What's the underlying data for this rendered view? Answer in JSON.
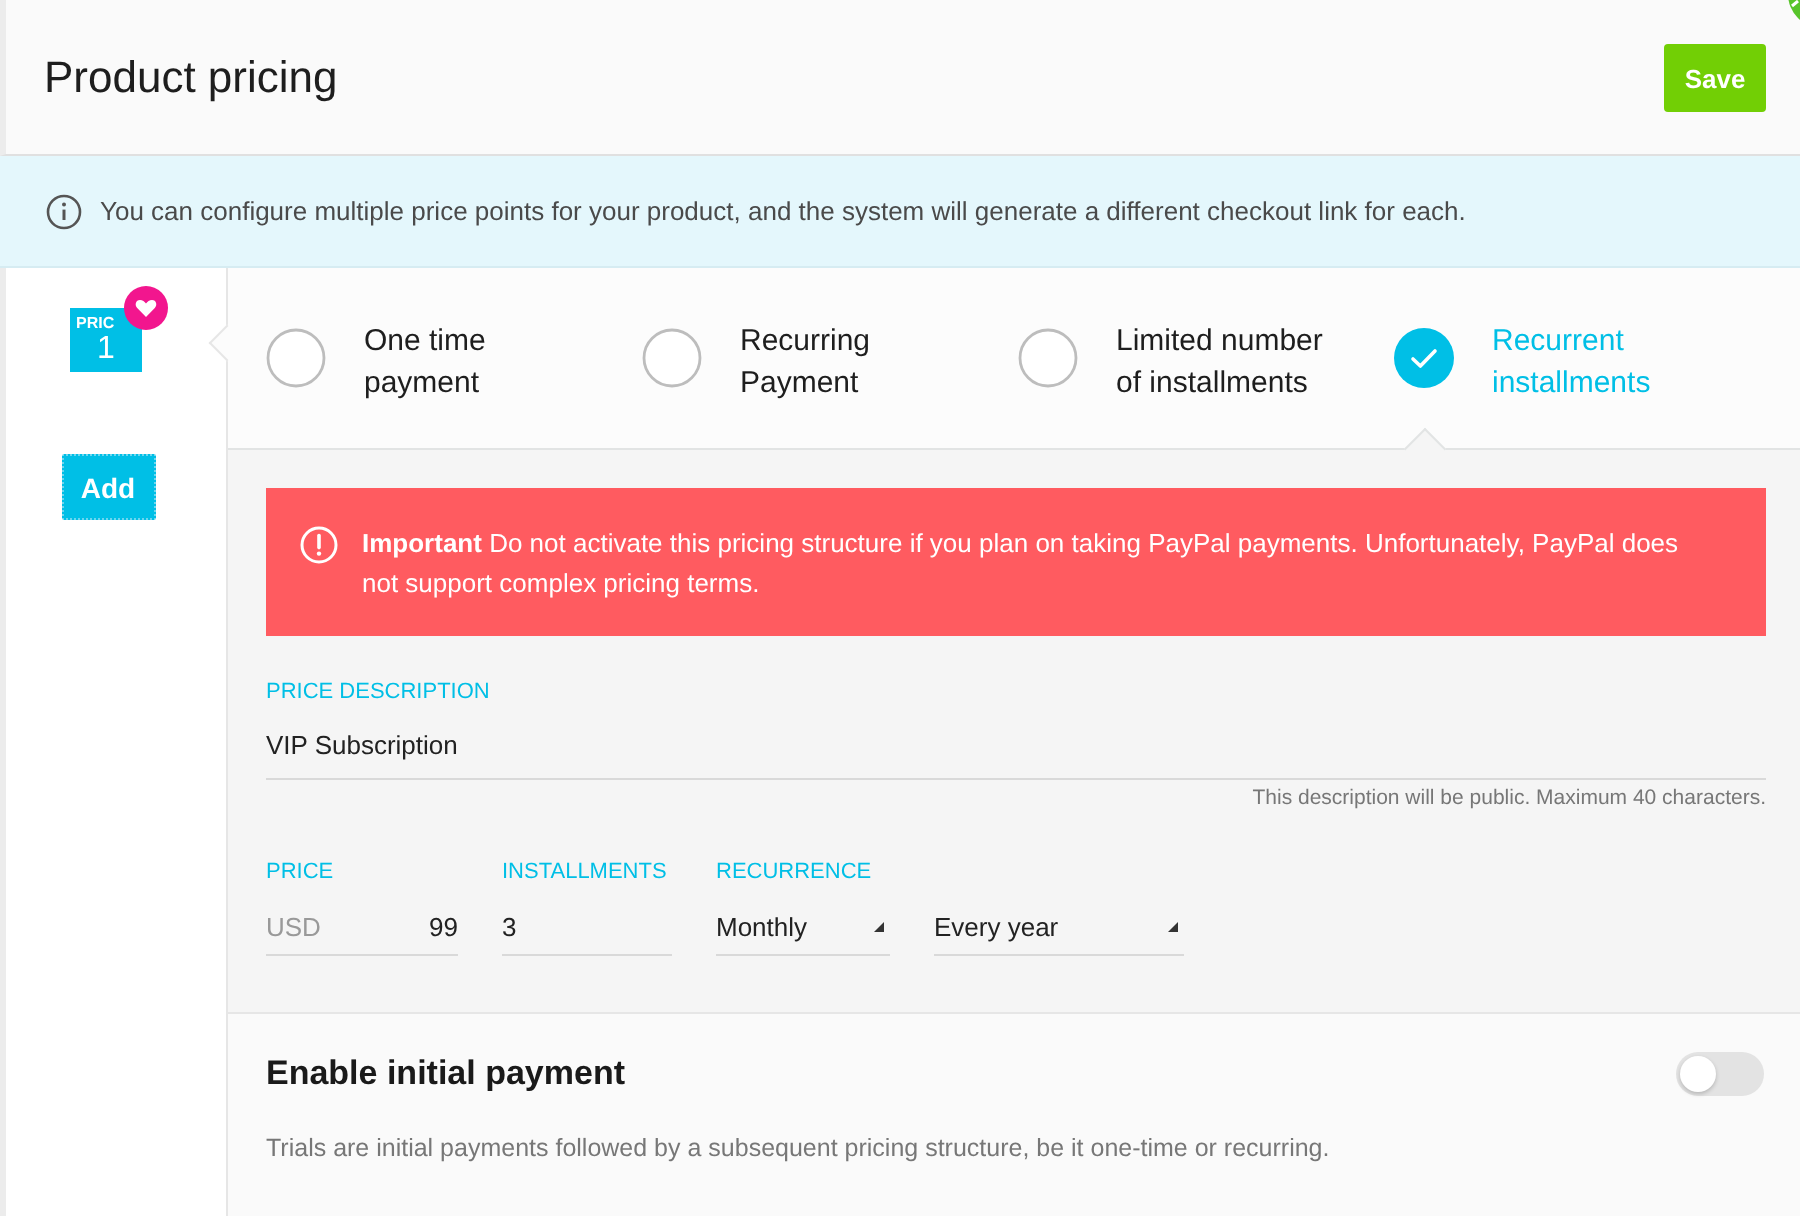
{
  "header": {
    "title": "Product pricing",
    "save_button": "Save"
  },
  "info_banner": {
    "text": "You can configure multiple price points for your product, and the system will generate a different checkout link for each."
  },
  "price_tabs": [
    {
      "label": "PRIC",
      "number": "1",
      "selected": true
    }
  ],
  "add_button": "Add",
  "pricing_types": [
    {
      "label": "One time payment",
      "selected": false
    },
    {
      "label": "Recurring Payment",
      "selected": false
    },
    {
      "label": "Limited number of installments",
      "selected": false
    },
    {
      "label": "Recurrent installments",
      "selected": true
    }
  ],
  "alert": {
    "text": "**Important** Do not activate this pricing structure if you plan on taking PayPal payments. Unfortunately, PayPal does not support complex pricing terms."
  },
  "description_field": {
    "label": "PRICE DESCRIPTION",
    "value": "VIP Subscription",
    "hint": "This description will be public. Maximum 40 characters."
  },
  "price_field": {
    "label": "PRICE",
    "currency": "USD",
    "value": "99"
  },
  "installments_field": {
    "label": "INSTALLMENTS",
    "value": "3"
  },
  "recurrence_field": {
    "label": "RECURRENCE",
    "value": "Monthly"
  },
  "period_field": {
    "value": "Every year"
  },
  "initial_payment": {
    "title": "Enable initial payment",
    "on": false,
    "description": "Trials are initial payments followed by a subsequent pricing structure, be it one-time or recurring."
  }
}
